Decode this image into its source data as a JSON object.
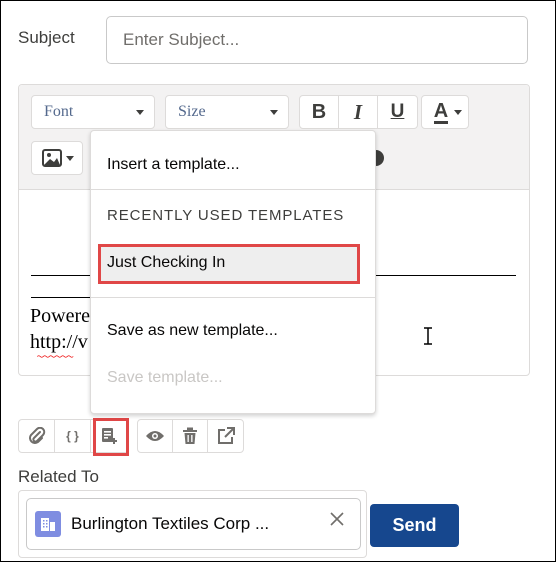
{
  "subject": {
    "label": "Subject",
    "placeholder": "Enter Subject..."
  },
  "toolbar": {
    "font": "Font",
    "size": "Size",
    "bold": "B",
    "italic": "I",
    "underline": "U",
    "text_color": "A"
  },
  "body": {
    "powered_fragment": "Powere",
    "link_fragment": "http://v"
  },
  "template_menu": {
    "insert": "Insert a template...",
    "header": "RECENTLY USED TEMPLATES",
    "recent": [
      "Just Checking In"
    ],
    "save_new": "Save as new template...",
    "save": "Save template..."
  },
  "related": {
    "label": "Related To",
    "value": "Burlington Textiles Corp ..."
  },
  "send_label": "Send",
  "colors": {
    "accent": "#16478e",
    "highlight": "#e04747",
    "account_icon": "#7f8de1"
  }
}
